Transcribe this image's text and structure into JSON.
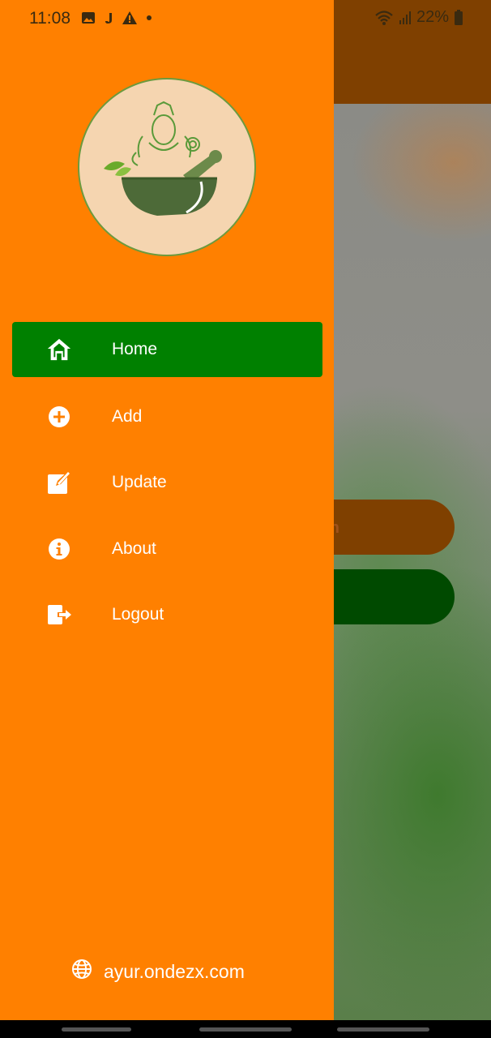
{
  "status_bar": {
    "time": "11:08",
    "battery": "22%",
    "icons_left": [
      "image-icon",
      "j-icon",
      "warning-icon",
      "dot-icon"
    ],
    "icons_right": [
      "wifi-icon",
      "signal-icon",
      "battery-icon"
    ]
  },
  "drawer": {
    "logo_icon": "ayurveda-mortar-logo",
    "menu": [
      {
        "label": "Home",
        "icon": "home-icon",
        "active": true
      },
      {
        "label": "Add",
        "icon": "add-circle-icon",
        "active": false
      },
      {
        "label": "Update",
        "icon": "edit-icon",
        "active": false
      },
      {
        "label": "About",
        "icon": "info-icon",
        "active": false
      },
      {
        "label": "Logout",
        "icon": "logout-icon",
        "active": false
      }
    ],
    "footer_link": "ayur.ondezx.com",
    "footer_icon": "globe-icon"
  },
  "background": {
    "button1_partial_text": "n"
  },
  "colors": {
    "drawer": "#ff8000",
    "active_item": "#008000",
    "app_bar_dimmed": "#7f4000",
    "button_green_dimmed": "#004a00"
  }
}
